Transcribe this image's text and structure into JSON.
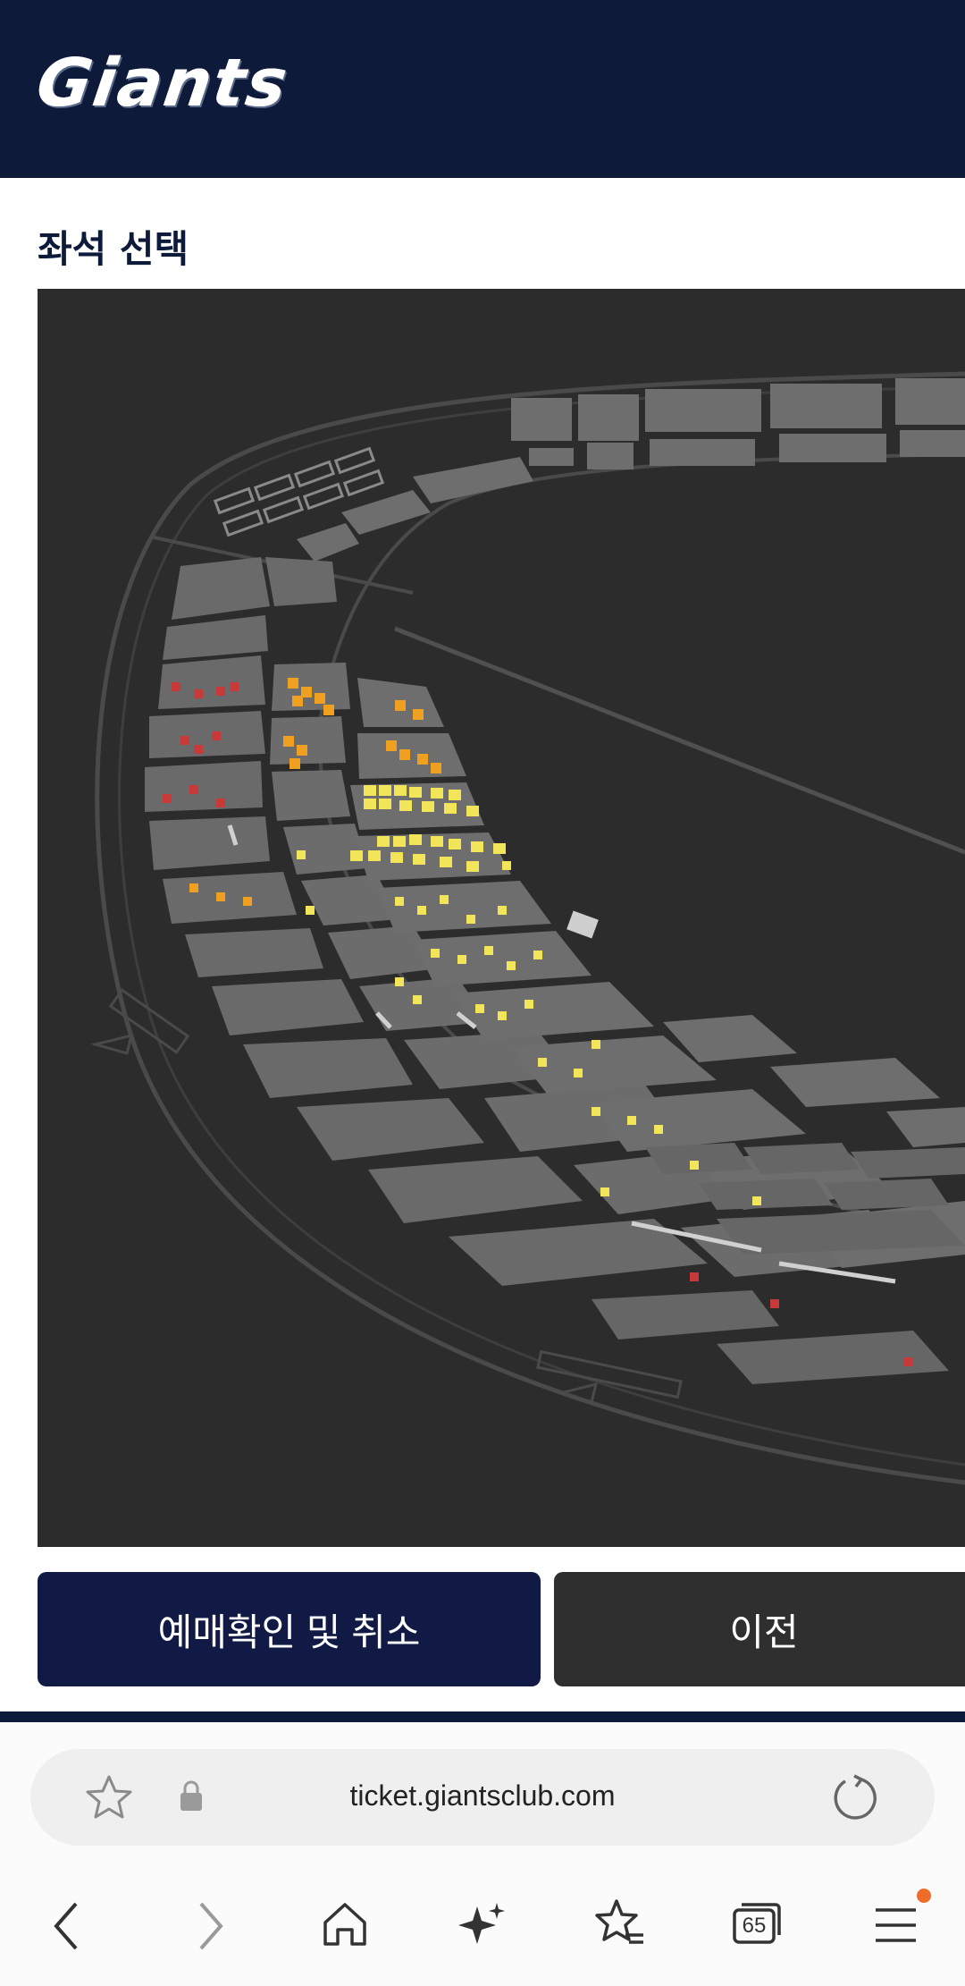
{
  "header": {
    "logo_text": "Giants"
  },
  "page": {
    "section_title": "좌석 선택"
  },
  "buttons": {
    "confirm_cancel": "예매확인 및 취소",
    "previous": "이전"
  },
  "browser": {
    "url": "ticket.giantsclub.com",
    "tab_count": "65"
  },
  "colors": {
    "header_bg": "#0e1a3a",
    "map_bg": "#2c2c2c",
    "seat_gray": "#707070",
    "seat_yellow": "#f2e55a",
    "seat_orange": "#f0a020",
    "seat_red": "#c83a3a",
    "primary_button": "#101a45",
    "secondary_button": "#2f2f2f"
  },
  "icons": [
    "star-icon",
    "lock-icon",
    "refresh-icon",
    "back-icon",
    "forward-icon",
    "home-icon",
    "sparkle-icon",
    "bookmarks-icon",
    "tabs-icon",
    "menu-icon"
  ]
}
